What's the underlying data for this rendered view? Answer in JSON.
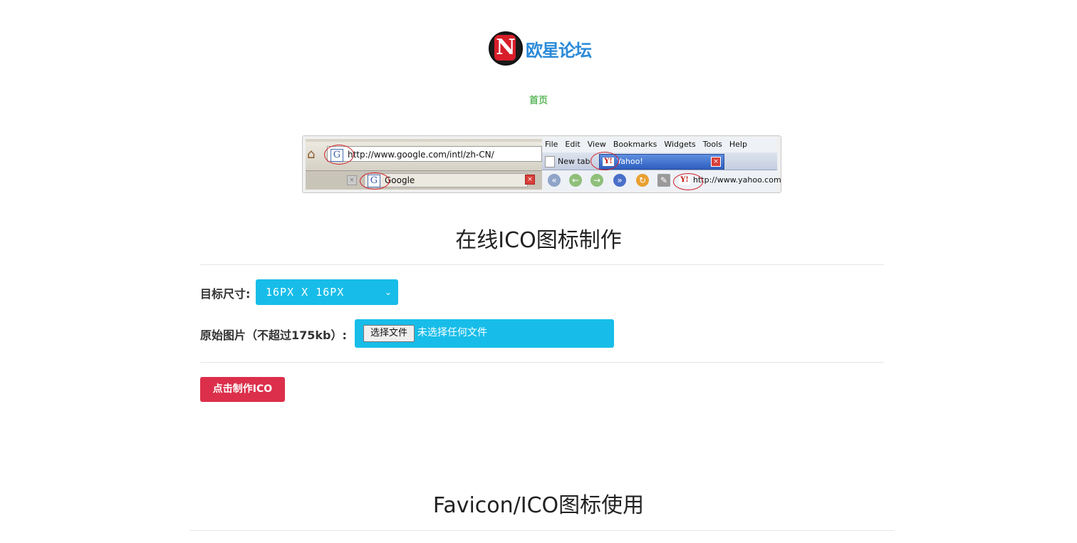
{
  "logo": {
    "text": "欧星论坛",
    "emblem_glyph": "N"
  },
  "nav": {
    "home_label": "首页"
  },
  "preview": {
    "left_url": "http://www.google.com/intl/zh-CN/",
    "left_tab_label": "Google",
    "menu": [
      "File",
      "Edit",
      "View",
      "Bookmarks",
      "Widgets",
      "Tools",
      "Help"
    ],
    "newtab_label": "New tab",
    "yahoo_tab_label": "Yahoo!",
    "right_url": "http://www.yahoo.com",
    "g_glyph": "G",
    "y_glyph": "Y!"
  },
  "maker": {
    "title": "在线ICO图标制作",
    "size_label": "目标尺寸:",
    "size_value": "16PX X 16PX",
    "source_label": "原始图片（不超过175kb）:",
    "choose_file_label": "选择文件",
    "file_status": "未选择任何文件",
    "submit_label": "点击制作ICO"
  },
  "usage": {
    "title": "Favicon/ICO图标使用"
  },
  "colors": {
    "accent": "#17bde8",
    "primary_button": "#dc2f4b",
    "nav_green": "#5cb85c",
    "logo_blue": "#2a8ad8"
  }
}
